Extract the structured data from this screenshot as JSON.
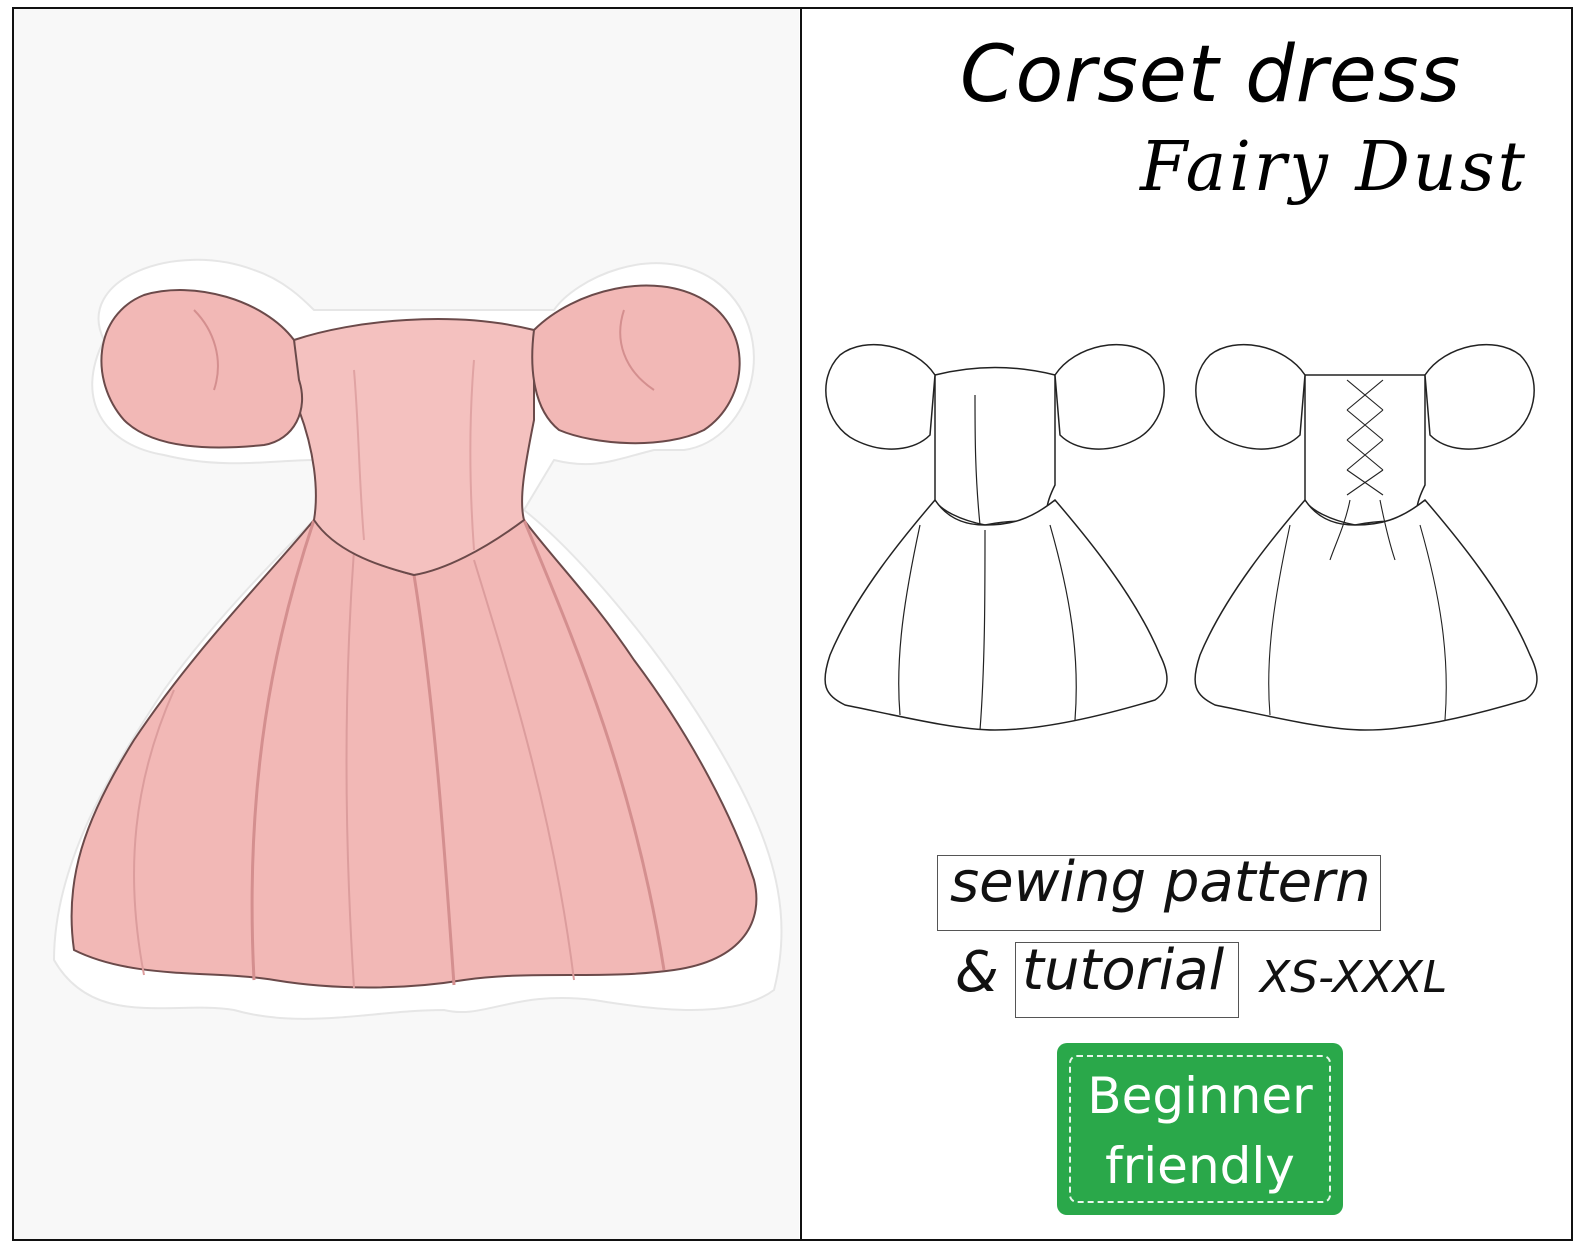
{
  "header": {
    "title": "Corset dress",
    "subtitle": "Fairy Dust"
  },
  "info": {
    "line1": "sewing pattern",
    "ampersand": "&",
    "line2": "tutorial",
    "sizes": "XS-XXXL"
  },
  "badge": {
    "line1": "Beginner",
    "line2": "friendly",
    "color": "#2aa84a"
  },
  "colors": {
    "dress_pink": "#f2b8b6",
    "dress_shadow": "#e49c9c",
    "outline": "#5a3a3a"
  }
}
